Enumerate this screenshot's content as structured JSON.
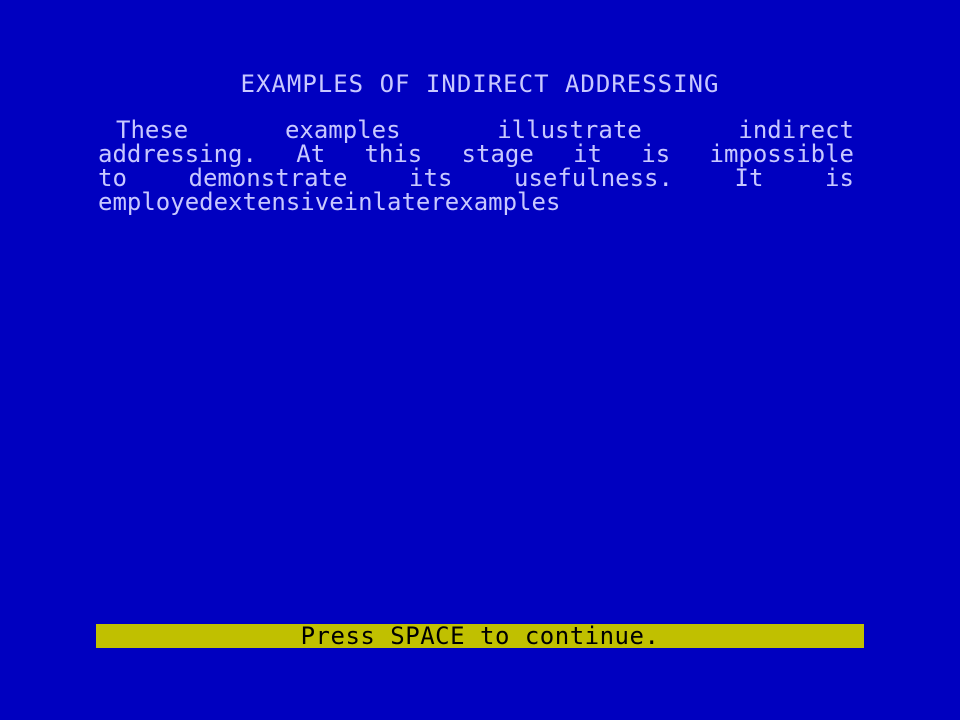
{
  "screen": {
    "title": "EXAMPLES OF INDIRECT ADDRESSING",
    "body_lines": [
      [
        "These",
        "examples",
        "illustrate",
        "indirect"
      ],
      [
        "addressing.",
        "At",
        "this",
        "stage",
        "it",
        "is",
        "impossible"
      ],
      [
        "to",
        "demonstrate",
        "its",
        "usefulness.",
        "It",
        "is"
      ],
      [
        "employed",
        "extensive",
        "in",
        "later",
        "examples"
      ]
    ],
    "prompt": "Press SPACE to continue."
  },
  "colors": {
    "background": "#0000c0",
    "text": "#c8c8ff",
    "prompt_bar": "#c0c000",
    "prompt_text": "#000000"
  }
}
